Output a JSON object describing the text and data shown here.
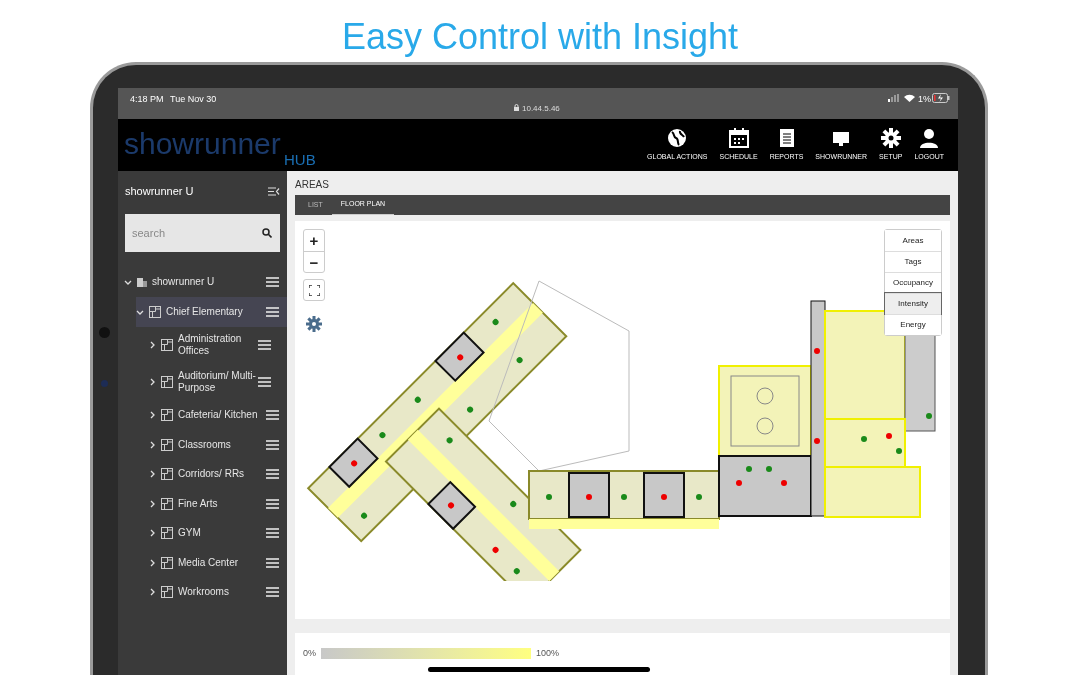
{
  "headline": "Easy Control with Insight",
  "status_bar": {
    "time": "4:18 PM",
    "date": "Tue Nov 30",
    "url": "10.44.5.46",
    "battery": "1%"
  },
  "app_header": {
    "logo": "showrunner",
    "logo_sub": "HUB",
    "actions": [
      {
        "label": "GLOBAL ACTIONS",
        "kind": "globe"
      },
      {
        "label": "SCHEDULE",
        "kind": "calendar"
      },
      {
        "label": "REPORTS",
        "kind": "report"
      },
      {
        "label": "SHOWRUNNER",
        "kind": "monitor"
      },
      {
        "label": "SETUP",
        "kind": "gear"
      },
      {
        "label": "LOGOUT",
        "kind": "user"
      }
    ]
  },
  "sidebar": {
    "title": "showrunner U",
    "search": {
      "placeholder": "search"
    },
    "tree": [
      {
        "label": "showrunner U",
        "kind": "site",
        "expanded": true,
        "selected": false,
        "children": [
          {
            "label": "Chief Elementary",
            "kind": "building",
            "expanded": true,
            "selected": true,
            "children": [
              {
                "label": "Administration Offices",
                "kind": "area",
                "expanded": false,
                "selected": false
              },
              {
                "label": "Auditorium/ Multi-Purpose",
                "kind": "area",
                "expanded": false,
                "selected": false
              },
              {
                "label": "Cafeteria/ Kitchen",
                "kind": "area",
                "expanded": false,
                "selected": false
              },
              {
                "label": "Classrooms",
                "kind": "area",
                "expanded": false,
                "selected": false
              },
              {
                "label": "Corridors/ RRs",
                "kind": "area",
                "expanded": false,
                "selected": false
              },
              {
                "label": "Fine Arts",
                "kind": "area",
                "expanded": false,
                "selected": false
              },
              {
                "label": "GYM",
                "kind": "area",
                "expanded": false,
                "selected": false
              },
              {
                "label": "Media Center",
                "kind": "area",
                "expanded": false,
                "selected": false
              },
              {
                "label": "Workrooms",
                "kind": "area",
                "expanded": false,
                "selected": false
              }
            ]
          }
        ]
      }
    ]
  },
  "main": {
    "title": "AREAS",
    "tabs": [
      {
        "label": "LIST",
        "selected": false
      },
      {
        "label": "FLOOR PLAN",
        "selected": true
      }
    ],
    "layers": [
      {
        "label": "Areas",
        "selected": false
      },
      {
        "label": "Tags",
        "selected": false
      },
      {
        "label": "Occupancy",
        "selected": false
      },
      {
        "label": "Intensity",
        "selected": true
      },
      {
        "label": "Energy",
        "selected": false
      }
    ],
    "map_controls": [
      {
        "label": "+"
      },
      {
        "label": "−"
      }
    ],
    "legend": {
      "min": "0%",
      "max": "100%"
    }
  }
}
